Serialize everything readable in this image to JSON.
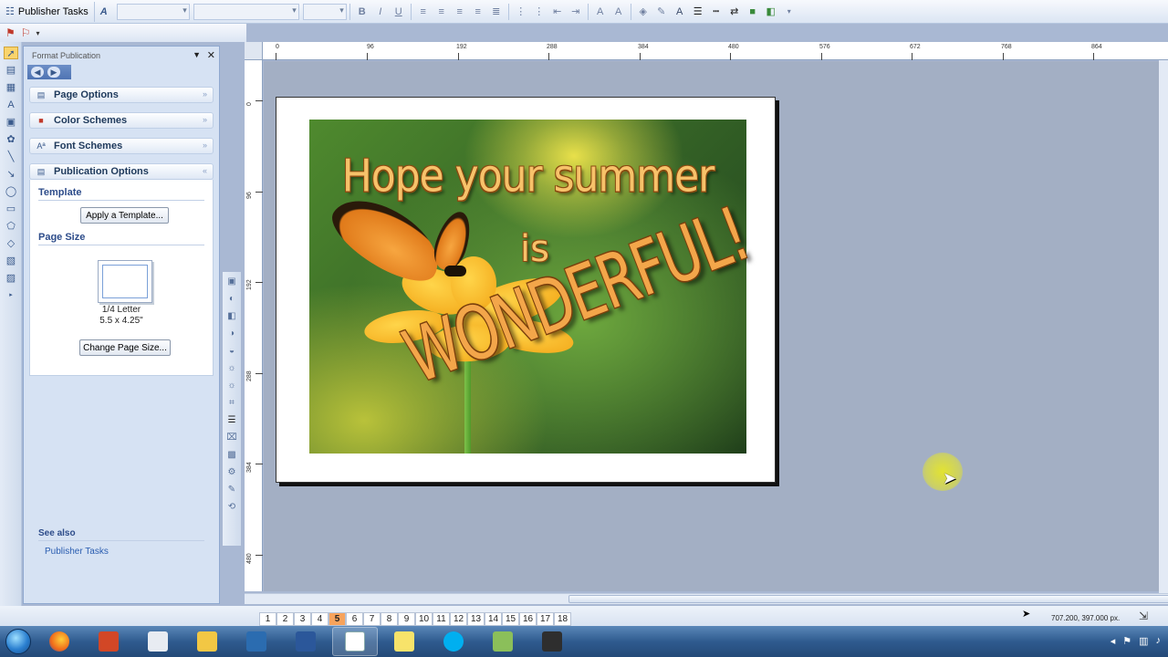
{
  "toolbar": {
    "task_label": "Publisher Tasks",
    "font_style": "",
    "font_name": "",
    "font_size": ""
  },
  "task_pane": {
    "title": "Format Publication",
    "sections": [
      {
        "label": "Page Options"
      },
      {
        "label": "Color Schemes"
      },
      {
        "label": "Font Schemes"
      },
      {
        "label": "Publication Options"
      }
    ],
    "template_heading": "Template",
    "apply_template_label": "Apply a Template...",
    "page_size_heading": "Page Size",
    "page_size_name": "1/4 Letter",
    "page_size_dims": "5.5 x 4.25\"",
    "change_page_size_label": "Change Page Size...",
    "see_also_heading": "See also",
    "see_also_link": "Publisher Tasks"
  },
  "ruler": {
    "h_labels": [
      "0",
      "96",
      "192",
      "288",
      "384",
      "480",
      "576",
      "672",
      "768",
      "864"
    ],
    "v_labels": [
      "0",
      "96",
      "192",
      "288",
      "384",
      "480"
    ]
  },
  "publication": {
    "line1": "Hope your summer",
    "line2": "is",
    "line3": "WONDERFUL!"
  },
  "pages": {
    "numbers": [
      "1",
      "2",
      "3",
      "4",
      "5",
      "6",
      "7",
      "8",
      "9",
      "10",
      "11",
      "12",
      "13",
      "14",
      "15",
      "16",
      "17",
      "18"
    ],
    "active": "5"
  },
  "status": {
    "position": "707.200, 397.000 px."
  },
  "icons": {
    "colors": {
      "accent": "#f7a35c",
      "pane": "#d6e2f3",
      "workspace": "#a3afc4"
    }
  }
}
